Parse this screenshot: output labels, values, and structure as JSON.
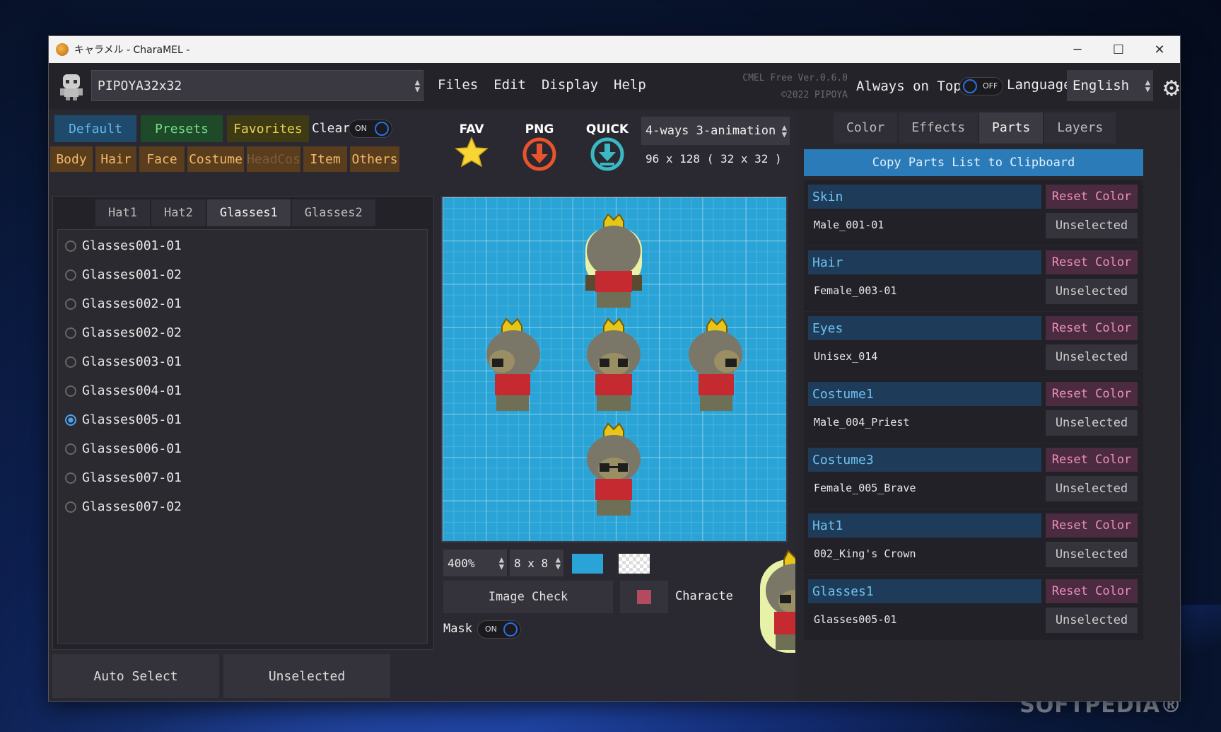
{
  "window": {
    "title": "キャラメル - CharaMEL -",
    "minimize": "─",
    "maximize": "☐",
    "close": "✕"
  },
  "topbar": {
    "preset": "PIPOYA32x32",
    "menu": [
      "Files",
      "Edit",
      "Display",
      "Help"
    ],
    "version_line1": "CMEL Free Ver.0.6.0",
    "version_line2": "©2022 PIPOYA",
    "always_on_top_label": "Always on Top",
    "always_on_top_state": "OFF",
    "language_label": "Language",
    "language_value": "English"
  },
  "left": {
    "mode_buttons": {
      "default": "Default",
      "presets": "Presets",
      "favorites": "Favorites"
    },
    "clear_label": "Clear",
    "clear_state": "ON",
    "categories": [
      "Body",
      "Hair",
      "Face",
      "Costume",
      "HeadCos",
      "Item",
      "Others"
    ],
    "subtabs": [
      "Hat1",
      "Hat2",
      "Glasses1",
      "Glasses2"
    ],
    "active_subtab": "Glasses1",
    "items": [
      "Glasses001-01",
      "Glasses001-02",
      "Glasses002-01",
      "Glasses002-02",
      "Glasses003-01",
      "Glasses004-01",
      "Glasses005-01",
      "Glasses006-01",
      "Glasses007-01",
      "Glasses007-02"
    ],
    "selected_item": "Glasses005-01",
    "auto_select": "Auto Select",
    "unselected": "Unselected"
  },
  "center": {
    "fav_label": "FAV",
    "png_label": "PNG",
    "quick_label": "QUICK",
    "animation": "4-ways 3-animation",
    "dimensions": "96 x 128 ( 32 x 32 )",
    "zoom": "400%",
    "grid": "8 x 8",
    "image_check": "Image Check",
    "character_label": "Characte",
    "mask_label": "Mask",
    "mask_state": "ON",
    "bg_color": "#2aa4d6"
  },
  "right": {
    "tabs": [
      "Color",
      "Effects",
      "Parts",
      "Layers"
    ],
    "active_tab": "Parts",
    "copy_button": "Copy Parts List to Clipboard",
    "reset_label": "Reset Color",
    "unselected_label": "Unselected",
    "parts": [
      {
        "name": "Skin",
        "value": "Male_001-01"
      },
      {
        "name": "Hair",
        "value": "Female_003-01"
      },
      {
        "name": "Eyes",
        "value": "Unisex_014"
      },
      {
        "name": "Costume1",
        "value": "Male_004_Priest"
      },
      {
        "name": "Costume3",
        "value": "Female_005_Brave"
      },
      {
        "name": "Hat1",
        "value": "002_King's Crown"
      },
      {
        "name": "Glasses1",
        "value": "Glasses005-01"
      }
    ]
  },
  "watermark": "SOFTPEDIA®"
}
